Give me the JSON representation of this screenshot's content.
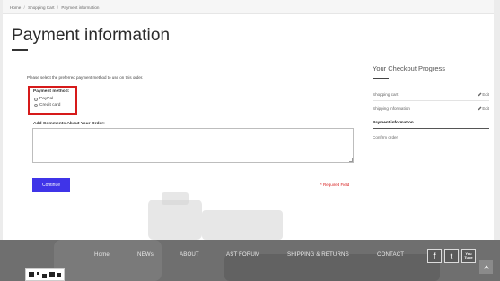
{
  "breadcrumb": {
    "home": "Home",
    "separator": "/",
    "cart": "Shopping Cart",
    "current": "Payment information"
  },
  "page_title": "Payment information",
  "intro_text": "Please select the preferred payment method to use on this order.",
  "payment_method": {
    "title": "Payment method:",
    "options": [
      "PayPal",
      "Credit card"
    ]
  },
  "comments": {
    "label": "Add Comments About Your Order:",
    "value": ""
  },
  "continue_label": "Continue",
  "required_note": "* Required Field",
  "checkout_progress": {
    "title": "Your Checkout Progress",
    "steps": [
      {
        "label": "Shopping cart",
        "edit": "Edit"
      },
      {
        "label": "Shipping information",
        "edit": "Edit"
      },
      {
        "label": "Payment information",
        "edit": ""
      },
      {
        "label": "Confirm order",
        "edit": ""
      }
    ]
  },
  "footer": {
    "links": [
      "Home",
      "NEWs",
      "ABOUT",
      "AST FORUM",
      "SHIPPING & RETURNS",
      "CONTACT"
    ],
    "social_icons": [
      "facebook-icon",
      "twitter-icon",
      "youtube-icon"
    ],
    "social_glyphs": [
      "f",
      "t",
      "You Tube"
    ]
  },
  "colors": {
    "accent": "#3f34e8",
    "highlight_border": "#d61a1a",
    "footer_bg": "#6f6f6f"
  }
}
